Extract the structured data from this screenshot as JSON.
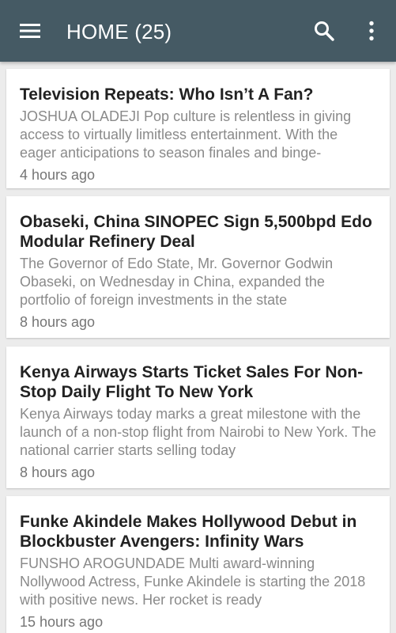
{
  "appbar": {
    "title": "HOME (25)",
    "background_color": "#455a64",
    "icons": {
      "menu": "hamburger-menu-icon",
      "search": "search-icon",
      "more": "more-vert-icon"
    }
  },
  "articles": [
    {
      "title": "Television Repeats: Who Isn’t A Fan?",
      "summary": "JOSHUA OLADEJI Pop culture is relentless in giving access to virtually limitless entertainment. With the eager anticipations to season finales and binge-",
      "time": "4 hours ago"
    },
    {
      "title": "Obaseki, China SINOPEC Sign 5,500bpd Edo Modular Refinery Deal",
      "summary": "The Governor of Edo State, Mr. Governor Godwin Obaseki, on Wednesday in China, expanded the portfolio of foreign investments in the state",
      "time": "8 hours ago"
    },
    {
      "title": "Kenya Airways Starts Ticket Sales For Non-Stop Daily Flight To New York",
      "summary": "Kenya Airways today marks a great milestone with the launch of a non-stop flight from Nairobi to New York. The national carrier starts selling today",
      "time": "8 hours ago"
    },
    {
      "title": "Funke Akindele Makes Hollywood Debut in Blockbuster Avengers: Infinity Wars",
      "summary": "FUNSHO AROGUNDADE Multi award-winning Nollywood Actress, Funke Akindele is starting the 2018 with positive news. Her rocket is ready",
      "time": "15 hours ago"
    }
  ]
}
